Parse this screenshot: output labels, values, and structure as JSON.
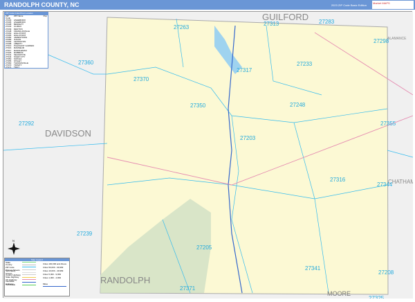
{
  "header": {
    "title": "RANDOLPH COUNTY, NC",
    "edition": "2023 ZIP Code Basic Edition",
    "logo": "Market MAPS"
  },
  "counties": [
    "GUILFORD",
    "DAVIDSON",
    "RANDOLPH",
    "CHATHAM",
    "MOORE",
    "ALAMANCE"
  ],
  "zip_labels": [
    "27263",
    "27313",
    "27283",
    "27298",
    "27360",
    "27317",
    "27233",
    "27370",
    "27350",
    "27248",
    "27292",
    "27355",
    "27203",
    "27316",
    "27344",
    "27239",
    "27205",
    "27341",
    "27208",
    "27371",
    "27325"
  ],
  "zip_list": {
    "title": "ZIP Code Index/Post Location",
    "headers": [
      "ZIP Code",
      "ZIP Name",
      "Pop"
    ],
    "rows": [
      [
        "27203",
        "ASHEBORO",
        ""
      ],
      [
        "27205",
        "ASHEBORO",
        ""
      ],
      [
        "27208",
        "BENNETT",
        ""
      ],
      [
        "27233",
        "CLIMAX",
        ""
      ],
      [
        "27239",
        "DENTON",
        ""
      ],
      [
        "27248",
        "FRANKLINVILLE",
        ""
      ],
      [
        "27263",
        "HIGH POINT",
        ""
      ],
      [
        "27265",
        "HIGH POINT",
        ""
      ],
      [
        "27282",
        "JAMESTOWN",
        ""
      ],
      [
        "27283",
        "JULIAN",
        ""
      ],
      [
        "27292",
        "LEXINGTON",
        ""
      ],
      [
        "27298",
        "LIBERTY",
        ""
      ],
      [
        "27313",
        "PLEASANT GARDEN",
        ""
      ],
      [
        "27316",
        "RAMSEUR",
        ""
      ],
      [
        "27317",
        "RANDLEMAN",
        ""
      ],
      [
        "27325",
        "ROBBINS",
        ""
      ],
      [
        "27341",
        "SEAGROVE",
        ""
      ],
      [
        "27344",
        "SILER CITY",
        ""
      ],
      [
        "27350",
        "SOPHIA",
        ""
      ],
      [
        "27355",
        "STALEY",
        ""
      ],
      [
        "27360",
        "THOMASVILLE",
        ""
      ],
      [
        "27370",
        "TRINITY",
        ""
      ],
      [
        "27371",
        "TROY",
        ""
      ]
    ]
  },
  "legend": {
    "title": "Map Legend",
    "items": [
      "State",
      "County",
      "ZIP Code",
      "Primary Streets",
      "Secondary Streets",
      "County Highway",
      "State Highway",
      "US Highway",
      "Interstate Highway",
      "Toll Roads"
    ],
    "population": [
      "Cities 100,000 and Above",
      "Cities 50,000 - 99,999",
      "Cities 10,000 - 49,999",
      "Cities 5,000 - 9,999",
      "Cities 1,000 - 4,999"
    ],
    "scale": "Miles",
    "compass": "N"
  },
  "colors": {
    "county_fill": "#fcf9d4",
    "outside": "#f0f0f0",
    "zip_line": "#33bbee",
    "header": "#6a96d6",
    "forest": "#cfe0c4"
  }
}
